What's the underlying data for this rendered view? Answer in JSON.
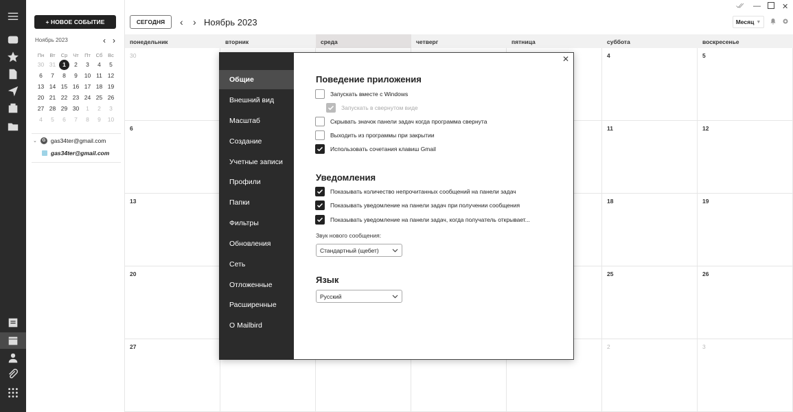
{
  "rail": {
    "icons": [
      "menu-icon",
      "inbox-icon",
      "star-icon",
      "document-icon",
      "send-icon",
      "archive-icon",
      "folder-icon",
      "notes-icon",
      "calendar-icon",
      "contacts-icon",
      "attachment-icon",
      "apps-icon"
    ]
  },
  "left_panel": {
    "new_event_label": "+ НОВОЕ СОБЫТИЕ",
    "mini_month": "Ноябрь 2023",
    "weekdays": [
      "Пн",
      "Вт",
      "Ср",
      "Чт",
      "Пт",
      "Сб",
      "Вс"
    ],
    "weeks": [
      [
        "30",
        "31",
        "1",
        "2",
        "3",
        "4",
        "5"
      ],
      [
        "6",
        "7",
        "8",
        "9",
        "10",
        "11",
        "12"
      ],
      [
        "13",
        "14",
        "15",
        "16",
        "17",
        "18",
        "19"
      ],
      [
        "20",
        "21",
        "22",
        "23",
        "24",
        "25",
        "26"
      ],
      [
        "27",
        "28",
        "29",
        "30",
        "1",
        "2",
        "3"
      ],
      [
        "4",
        "5",
        "6",
        "7",
        "8",
        "9",
        "10"
      ]
    ],
    "account_group": "gas34ter@gmail.com",
    "account_calendar": "gas34ter@gmail.com"
  },
  "toolbar": {
    "today_label": "СЕГОДНЯ",
    "month_title": "Ноябрь 2023",
    "view_label": "Месяц"
  },
  "calendar": {
    "days": [
      "понедельник",
      "вторник",
      "среда",
      "четверг",
      "пятница",
      "суббота",
      "воскресенье"
    ],
    "weeks": [
      [
        "30",
        "",
        "",
        "",
        "",
        "4",
        "5"
      ],
      [
        "6",
        "",
        "",
        "",
        "",
        "11",
        "12"
      ],
      [
        "13",
        "",
        "",
        "",
        "",
        "18",
        "19"
      ],
      [
        "20",
        "",
        "",
        "",
        "",
        "25",
        "26"
      ],
      [
        "27",
        "",
        "",
        "",
        "",
        "2",
        "3"
      ]
    ]
  },
  "settings": {
    "nav": [
      "Общие",
      "Внешний вид",
      "Масштаб",
      "Создание",
      "Учетные записи",
      "Профили",
      "Папки",
      "Фильтры",
      "Обновления",
      "Сеть",
      "Отложенные",
      "Расширенные",
      "О Mailbird"
    ],
    "behavior": {
      "title": "Поведение приложения",
      "opt_start": "Запускать вместе с Windows",
      "opt_minimized": "Запускать в свернутом виде",
      "opt_hide_tray": "Скрывать значок панели задач когда программа свернута",
      "opt_exit": "Выходить из программы при закрытии",
      "opt_gmail": "Использовать сочетания клавиш Gmail"
    },
    "notifications": {
      "title": "Уведомления",
      "opt_unread": "Показывать количество непрочитанных сообщений на панели задач",
      "opt_on_receive": "Показывать уведомление на панели задач при получении сообщения",
      "opt_on_open": "Показывать уведомление на панели задач, когда получатель открывает...",
      "sound_label": "Звук нового сообщения:",
      "sound_value": "Стандартный (щебет)"
    },
    "language": {
      "title": "Язык",
      "value": "Русский"
    }
  }
}
